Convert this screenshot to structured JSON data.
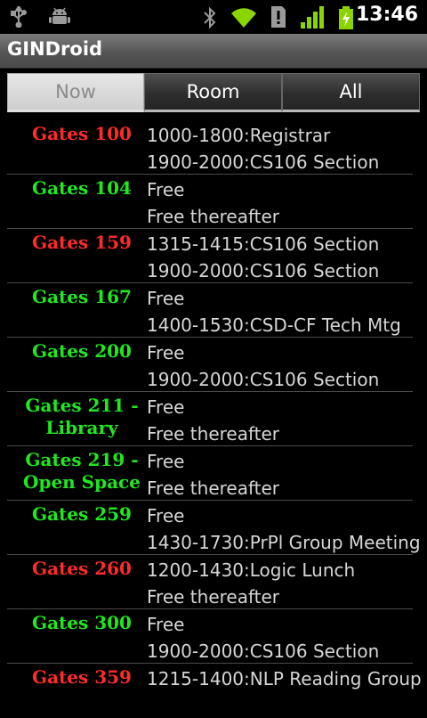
{
  "status_bar": {
    "time": "13:46",
    "icons": [
      "usb-icon",
      "android-debug-icon",
      "bluetooth-icon",
      "wifi-icon",
      "alert-icon",
      "signal-icon",
      "battery-charging-icon"
    ]
  },
  "app": {
    "title": "GINDroid"
  },
  "tabs": [
    {
      "label": "Now",
      "active": true
    },
    {
      "label": "Room",
      "active": false
    },
    {
      "label": "All",
      "active": false
    }
  ],
  "colors": {
    "busy": "#ff2a2a",
    "free": "#1fe81f"
  },
  "rooms": [
    {
      "name": "Gates 100",
      "status": "busy",
      "line1": "1000-1800:Registrar",
      "line2": "1900-2000:CS106 Section"
    },
    {
      "name": "Gates 104",
      "status": "free",
      "line1": "Free",
      "line2": "Free thereafter"
    },
    {
      "name": "Gates 159",
      "status": "busy",
      "line1": "1315-1415:CS106 Section",
      "line2": "1900-2000:CS106 Section"
    },
    {
      "name": "Gates 167",
      "status": "free",
      "line1": "Free",
      "line2": "1400-1530:CSD-CF Tech Mtg"
    },
    {
      "name": "Gates 200",
      "status": "free",
      "line1": "Free",
      "line2": "1900-2000:CS106 Section"
    },
    {
      "name": "Gates 211 - Library",
      "name1": "Gates 211 -",
      "name2": "Library",
      "status": "free",
      "line1": "Free",
      "line2": "Free thereafter"
    },
    {
      "name": "Gates 219 - Open Space",
      "name1": "Gates 219 -",
      "name2": "Open Space",
      "status": "free",
      "line1": "Free",
      "line2": "Free thereafter"
    },
    {
      "name": "Gates 259",
      "status": "free",
      "line1": "Free",
      "line2": "1430-1730:PrPl Group Meeting"
    },
    {
      "name": "Gates 260",
      "status": "busy",
      "line1": "1200-1430:Logic Lunch",
      "line2": "Free thereafter"
    },
    {
      "name": "Gates 300",
      "status": "free",
      "line1": "Free",
      "line2": "1900-2000:CS106 Section"
    },
    {
      "name": "Gates 359",
      "status": "busy",
      "line1": "1215-1400:NLP Reading Group",
      "line2": ""
    }
  ]
}
